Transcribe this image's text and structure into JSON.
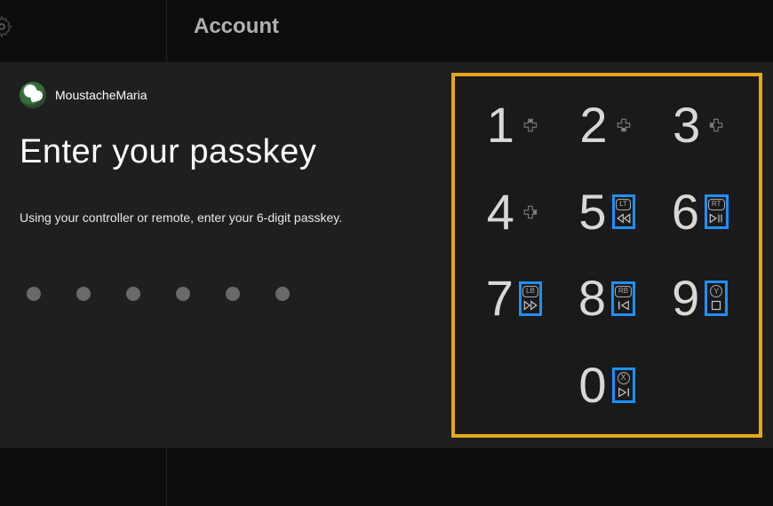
{
  "header": {
    "section_label": "Account"
  },
  "user": {
    "name": "MoustacheMaria"
  },
  "content": {
    "heading": "Enter your passkey",
    "instruction": "Using your controller or remote, enter your 6-digit passkey.",
    "digit_count": 6
  },
  "keypad": {
    "keys": [
      {
        "digit": "1",
        "hint_type": "dpad-up",
        "highlighted": false
      },
      {
        "digit": "2",
        "hint_type": "dpad-down",
        "highlighted": false
      },
      {
        "digit": "3",
        "hint_type": "dpad-left",
        "highlighted": false
      },
      {
        "digit": "4",
        "hint_type": "dpad-right",
        "highlighted": false
      },
      {
        "digit": "5",
        "hint_type": "trigger",
        "tag": "LT",
        "media": "rewind",
        "highlighted": true
      },
      {
        "digit": "6",
        "hint_type": "trigger",
        "tag": "RT",
        "media": "play-pause",
        "highlighted": true
      },
      {
        "digit": "7",
        "hint_type": "bumper",
        "tag": "LB",
        "media": "fast-fwd",
        "highlighted": true
      },
      {
        "digit": "8",
        "hint_type": "bumper",
        "tag": "RB",
        "media": "prev",
        "highlighted": true
      },
      {
        "digit": "9",
        "hint_type": "button",
        "tag": "Y",
        "media": "stop",
        "highlighted": true
      },
      {
        "digit": "0",
        "hint_type": "button",
        "tag": "X",
        "media": "next",
        "highlighted": true
      }
    ]
  },
  "colors": {
    "frame_highlight": "#e6a817",
    "hint_highlight": "#1e90ff"
  }
}
